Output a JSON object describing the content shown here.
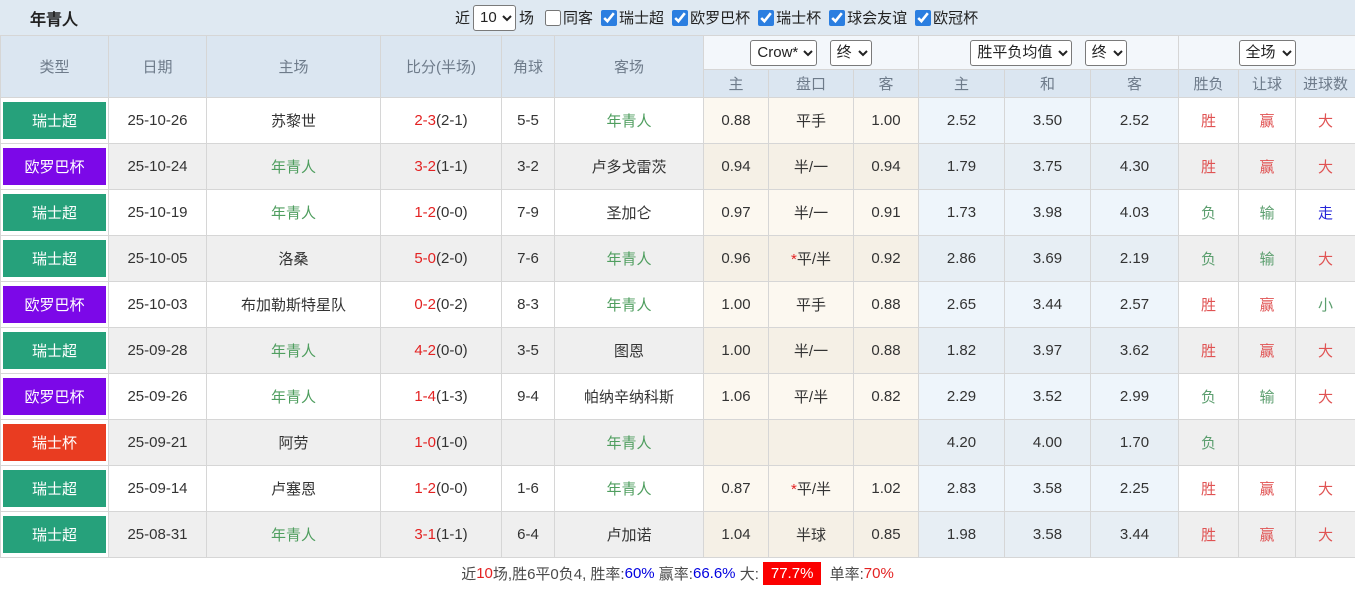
{
  "colors": {
    "league": {
      "瑞士超": "#26a17b",
      "欧罗巴杯": "#7c08e8",
      "瑞士杯": "#e93c21"
    },
    "result": {
      "胜": "red",
      "赢": "red",
      "大": "red",
      "负": "green",
      "输": "green",
      "小": "green",
      "走": "blue"
    },
    "accent_checkbox": "#2b7ee0",
    "team_highlight": "#4f9e5f",
    "score_red": "#e32222"
  },
  "header": {
    "title": "年青人",
    "recent_label": "近",
    "recent_value": "10",
    "recent_suffix": "场",
    "filters": [
      {
        "label": "同客",
        "checked": false
      },
      {
        "label": "瑞士超",
        "checked": true
      },
      {
        "label": "欧罗巴杯",
        "checked": true
      },
      {
        "label": "瑞士杯",
        "checked": true
      },
      {
        "label": "球会友谊",
        "checked": true
      },
      {
        "label": "欧冠杯",
        "checked": true
      }
    ]
  },
  "table": {
    "columns_left": [
      "类型",
      "日期",
      "主场",
      "比分(半场)",
      "角球",
      "客场"
    ],
    "selects": {
      "asia_company": "Crow*",
      "asia_time": "终",
      "europe_company": "胜平负均值",
      "europe_time": "终",
      "result_scope": "全场"
    },
    "sub_headers": [
      "主",
      "盘口",
      "客",
      "主",
      "和",
      "客",
      "胜负",
      "让球",
      "进球数"
    ],
    "rows": [
      {
        "league": "瑞士超",
        "date": "25-10-26",
        "home": "苏黎世",
        "home_team": false,
        "score": "2-3",
        "half": "(2-1)",
        "corner": "5-5",
        "away": "年青人",
        "away_team": true,
        "asia_home": "0.88",
        "handicap": "平手",
        "handicap_star": false,
        "asia_away": "1.00",
        "eu_home": "2.52",
        "eu_draw": "3.50",
        "eu_away": "2.52",
        "wl": "胜",
        "let": "赢",
        "goals": "大"
      },
      {
        "league": "欧罗巴杯",
        "date": "25-10-24",
        "home": "年青人",
        "home_team": true,
        "score": "3-2",
        "half": "(1-1)",
        "corner": "3-2",
        "away": "卢多戈雷茨",
        "away_team": false,
        "asia_home": "0.94",
        "handicap": "半/一",
        "handicap_star": false,
        "asia_away": "0.94",
        "eu_home": "1.79",
        "eu_draw": "3.75",
        "eu_away": "4.30",
        "wl": "胜",
        "let": "赢",
        "goals": "大"
      },
      {
        "league": "瑞士超",
        "date": "25-10-19",
        "home": "年青人",
        "home_team": true,
        "score": "1-2",
        "half": "(0-0)",
        "corner": "7-9",
        "away": "圣加仑",
        "away_team": false,
        "asia_home": "0.97",
        "handicap": "半/一",
        "handicap_star": false,
        "asia_away": "0.91",
        "eu_home": "1.73",
        "eu_draw": "3.98",
        "eu_away": "4.03",
        "wl": "负",
        "let": "输",
        "goals": "走"
      },
      {
        "league": "瑞士超",
        "date": "25-10-05",
        "home": "洛桑",
        "home_team": false,
        "score": "5-0",
        "half": "(2-0)",
        "corner": "7-6",
        "away": "年青人",
        "away_team": true,
        "asia_home": "0.96",
        "handicap": "平/半",
        "handicap_star": true,
        "asia_away": "0.92",
        "eu_home": "2.86",
        "eu_draw": "3.69",
        "eu_away": "2.19",
        "wl": "负",
        "let": "输",
        "goals": "大"
      },
      {
        "league": "欧罗巴杯",
        "date": "25-10-03",
        "home": "布加勒斯特星队",
        "home_team": false,
        "score": "0-2",
        "half": "(0-2)",
        "corner": "8-3",
        "away": "年青人",
        "away_team": true,
        "asia_home": "1.00",
        "handicap": "平手",
        "handicap_star": false,
        "asia_away": "0.88",
        "eu_home": "2.65",
        "eu_draw": "3.44",
        "eu_away": "2.57",
        "wl": "胜",
        "let": "赢",
        "goals": "小"
      },
      {
        "league": "瑞士超",
        "date": "25-09-28",
        "home": "年青人",
        "home_team": true,
        "score": "4-2",
        "half": "(0-0)",
        "corner": "3-5",
        "away": "图恩",
        "away_team": false,
        "asia_home": "1.00",
        "handicap": "半/一",
        "handicap_star": false,
        "asia_away": "0.88",
        "eu_home": "1.82",
        "eu_draw": "3.97",
        "eu_away": "3.62",
        "wl": "胜",
        "let": "赢",
        "goals": "大"
      },
      {
        "league": "欧罗巴杯",
        "date": "25-09-26",
        "home": "年青人",
        "home_team": true,
        "score": "1-4",
        "half": "(1-3)",
        "corner": "9-4",
        "away": "帕纳辛纳科斯",
        "away_team": false,
        "asia_home": "1.06",
        "handicap": "平/半",
        "handicap_star": false,
        "asia_away": "0.82",
        "eu_home": "2.29",
        "eu_draw": "3.52",
        "eu_away": "2.99",
        "wl": "负",
        "let": "输",
        "goals": "大"
      },
      {
        "league": "瑞士杯",
        "date": "25-09-21",
        "home": "阿劳",
        "home_team": false,
        "score": "1-0",
        "half": "(1-0)",
        "corner": "",
        "away": "年青人",
        "away_team": true,
        "asia_home": "",
        "handicap": "",
        "handicap_star": false,
        "asia_away": "",
        "eu_home": "4.20",
        "eu_draw": "4.00",
        "eu_away": "1.70",
        "wl": "负",
        "let": "",
        "goals": ""
      },
      {
        "league": "瑞士超",
        "date": "25-09-14",
        "home": "卢塞恩",
        "home_team": false,
        "score": "1-2",
        "half": "(0-0)",
        "corner": "1-6",
        "away": "年青人",
        "away_team": true,
        "asia_home": "0.87",
        "handicap": "平/半",
        "handicap_star": true,
        "asia_away": "1.02",
        "eu_home": "2.83",
        "eu_draw": "3.58",
        "eu_away": "2.25",
        "wl": "胜",
        "let": "赢",
        "goals": "大"
      },
      {
        "league": "瑞士超",
        "date": "25-08-31",
        "home": "年青人",
        "home_team": true,
        "score": "3-1",
        "half": "(1-1)",
        "corner": "6-4",
        "away": "卢加诺",
        "away_team": false,
        "asia_home": "1.04",
        "handicap": "半球",
        "handicap_star": false,
        "asia_away": "0.85",
        "eu_home": "1.98",
        "eu_draw": "3.58",
        "eu_away": "3.44",
        "wl": "胜",
        "let": "赢",
        "goals": "大"
      }
    ]
  },
  "footer": {
    "segments": [
      {
        "text": "近",
        "style": "plain"
      },
      {
        "text": "10",
        "style": "red"
      },
      {
        "text": "场,胜6平0负4, 胜率:",
        "style": "plain"
      },
      {
        "text": "60%",
        "style": "blue"
      },
      {
        "text": " 赢率:",
        "style": "plain"
      },
      {
        "text": "66.6%",
        "style": "blue"
      },
      {
        "text": " 大:",
        "style": "plain"
      },
      {
        "text": "77.7%",
        "style": "red-badge"
      },
      {
        "text": " 单率:",
        "style": "plain"
      },
      {
        "text": "70%",
        "style": "red"
      }
    ]
  }
}
